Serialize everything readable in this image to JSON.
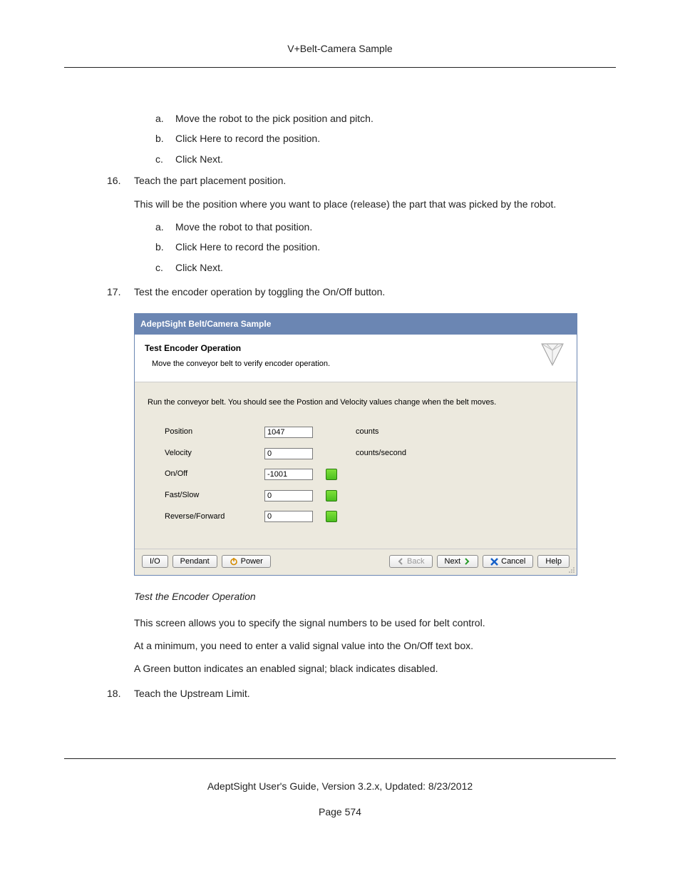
{
  "header": {
    "title": "V+Belt-Camera Sample"
  },
  "steps": {
    "s15": {
      "a": "Move the robot to the pick position and pitch.",
      "b": "Click Here to record the position.",
      "c": "Click Next."
    },
    "s16": {
      "num": "16.",
      "title": "Teach the part placement position.",
      "desc": "This will be the position where you want to place (release) the part that was picked by the robot.",
      "a": "Move the robot to that position.",
      "b": "Click Here to record the position.",
      "c": "Click Next."
    },
    "s17": {
      "num": "17.",
      "title": "Test the encoder operation by toggling the On/Off button.",
      "caption": "Test the Encoder Operation",
      "p1": "This screen allows you to specify the signal numbers to be used for belt control.",
      "p2": "At a minimum, you need to enter a valid signal value into the On/Off text box.",
      "p3": "A Green button indicates an enabled signal; black indicates disabled."
    },
    "s18": {
      "num": "18.",
      "title": "Teach the Upstream Limit."
    }
  },
  "dialog": {
    "titlebar": "AdeptSight Belt/Camera Sample",
    "head_title": "Test Encoder Operation",
    "head_sub": "Move the conveyor belt to verify encoder operation.",
    "instr": "Run the conveyor belt.  You should see the Postion and Velocity values change when the belt moves.",
    "fields": {
      "position": {
        "label": "Position",
        "value": "1047",
        "unit": "counts"
      },
      "velocity": {
        "label": "Velocity",
        "value": "0",
        "unit": "counts/second"
      },
      "onoff": {
        "label": "On/Off",
        "value": "-1001"
      },
      "fastslow": {
        "label": "Fast/Slow",
        "value": "0"
      },
      "revfwd": {
        "label": "Reverse/Forward",
        "value": "0"
      }
    },
    "buttons": {
      "io": "I/O",
      "pendant": "Pendant",
      "power": "Power",
      "back": "Back",
      "next": "Next",
      "cancel": "Cancel",
      "help": "Help"
    }
  },
  "footer": {
    "line": "AdeptSight User's Guide,  Version 3.2.x, Updated: 8/23/2012",
    "page": "Page 574"
  }
}
